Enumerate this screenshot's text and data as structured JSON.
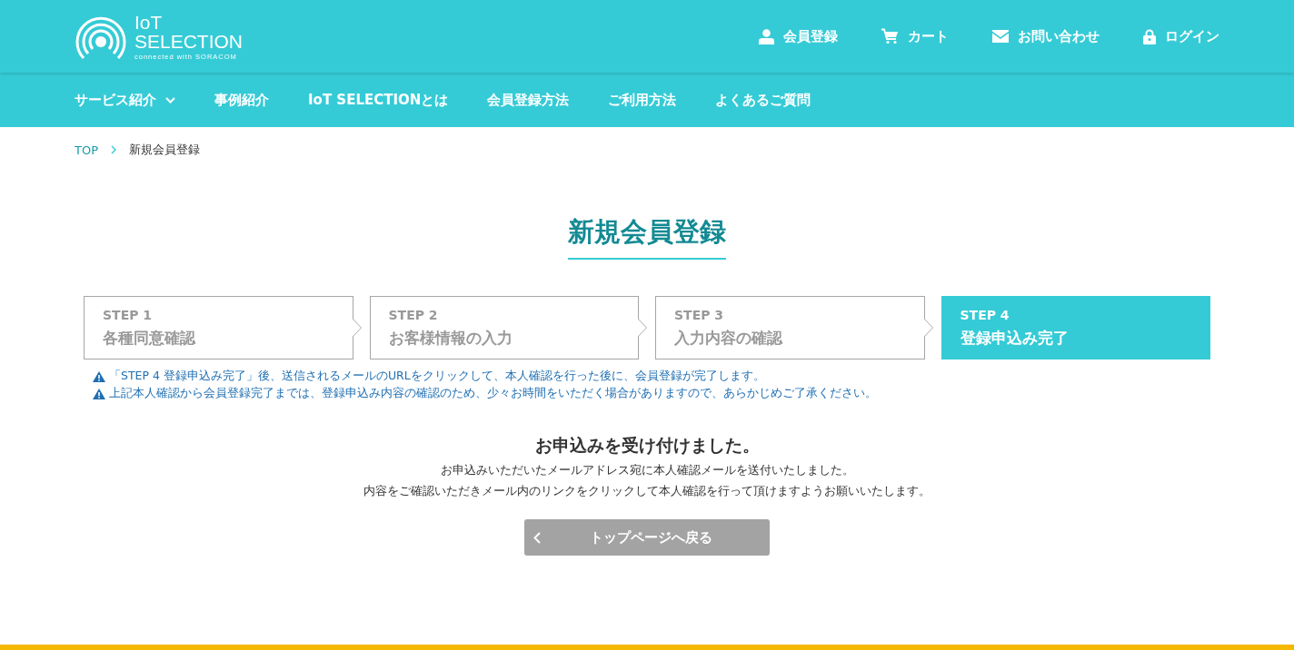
{
  "logo": {
    "line1": "IoT",
    "line2": "SELECTION",
    "tagline": "connected with SORACOM"
  },
  "header_links": [
    {
      "kind": "user",
      "label": "会員登録"
    },
    {
      "kind": "cart",
      "label": "カート"
    },
    {
      "kind": "mail",
      "label": "お問い合わせ"
    },
    {
      "kind": "lock",
      "label": "ログイン"
    }
  ],
  "nav": [
    {
      "label": "サービス紹介",
      "dropdown": true
    },
    {
      "label": "事例紹介",
      "dropdown": false
    },
    {
      "label": "IoT SELECTIONとは",
      "dropdown": false
    },
    {
      "label": "会員登録方法",
      "dropdown": false
    },
    {
      "label": "ご利用方法",
      "dropdown": false
    },
    {
      "label": "よくあるご質問",
      "dropdown": false
    }
  ],
  "breadcrumb": [
    "TOP",
    "新規会員登録"
  ],
  "page_title": "新規会員登録",
  "steps": [
    {
      "step": "STEP 1",
      "label": "各種同意確認",
      "selected": false
    },
    {
      "step": "STEP 2",
      "label": "お客様情報の入力",
      "selected": false
    },
    {
      "step": "STEP 3",
      "label": "入力内容の確認",
      "selected": false
    },
    {
      "step": "STEP 4",
      "label": "登録申込み完了",
      "selected": true
    }
  ],
  "notes": [
    "「STEP 4 登録申込み完了」後、送信されるメールのURLをクリックして、本人確認を行った後に、会員登録が完了します。",
    "上記本人確認から会員登録完了までは、登録申込み内容の確認のため、少々お時間をいただく場合がありますので、あらかじめご了承ください。"
  ],
  "message": {
    "heading": "お申込みを受け付けました。",
    "lines": [
      "お申込みいただいたメールアドレス宛に本人確認メールを送付いたしました。",
      "内容をご確認いただきメール内のリンクをクリックして本人確認を行って頂けますようお願いいたします。"
    ]
  },
  "back_button": "トップページへ戻る"
}
